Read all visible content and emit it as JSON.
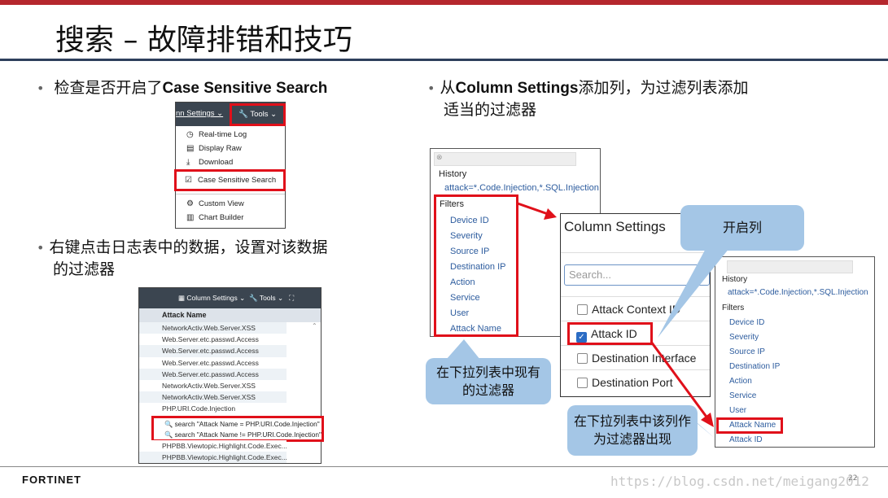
{
  "slide": {
    "title": "搜索 – 故障排错和技巧",
    "page_number": "22",
    "watermark": "https://blog.csdn.net/meigang2012",
    "logo_text": "FORTINET",
    "accent_color": "#b5272d",
    "rule_color": "#2e3f5c",
    "callout_color": "#a4c6e6"
  },
  "bullets": [
    {
      "pre": "检查是否开启了",
      "bold": "Case Sensitive Search",
      "post": ""
    },
    {
      "line1": "右键点击日志表中的数据，设置对该数据",
      "line2": "的过滤器"
    },
    {
      "pre": "从",
      "bold": "Column Settings",
      "post": "添加列，为过滤列表添加",
      "line2": "适当的过滤器"
    }
  ],
  "tools_menu": {
    "column_settings": "nn Settings ⌄",
    "tools": "Tools ⌄",
    "items": [
      {
        "icon": "clock-icon",
        "label": "Real-time Log"
      },
      {
        "icon": "document-icon",
        "label": "Display Raw"
      },
      {
        "icon": "download-icon",
        "label": "Download"
      },
      {
        "icon": "checkbox-icon",
        "label": "Case Sensitive Search"
      },
      {
        "icon": "user-settings-icon",
        "label": "Custom View"
      },
      {
        "icon": "bar-chart-icon",
        "label": "Chart Builder"
      }
    ]
  },
  "log_table": {
    "column_settings": "Column Settings ⌄",
    "tools": "Tools ⌄",
    "header": "Attack Name",
    "rows": [
      "NetworkActiv.Web.Server.XSS",
      "Web.Server.etc.passwd.Access",
      "Web.Server.etc.passwd.Access",
      "Web.Server.etc.passwd.Access",
      "Web.Server.etc.passwd.Access",
      "NetworkActiv.Web.Server.XSS",
      "NetworkActiv.Web.Server.XSS",
      "PHP.URI.Code.Injection"
    ],
    "context_menu": [
      "search \"Attack Name = PHP.URI.Code.Injection\"",
      "search \"Attack Name != PHP.URI.Code.Injection\""
    ],
    "rows_after": [
      "PHPBB.Viewtopic.Highlight.Code.Exec...",
      "PHPBB.Viewtopic.Highlight.Code.Exec..."
    ]
  },
  "filter_dropdown_1": {
    "history_label": "History",
    "history_item": "attack=*.Code.Injection,*.SQL.Injection",
    "filters_label": "Filters",
    "filters": [
      "Device ID",
      "Severity",
      "Source IP",
      "Destination IP",
      "Action",
      "Service",
      "User",
      "Attack Name"
    ]
  },
  "column_settings": {
    "title": "Column Settings",
    "search_placeholder": "Search...",
    "items": [
      {
        "label": "Attack Context ID",
        "checked": false
      },
      {
        "label": "Attack ID",
        "checked": true
      },
      {
        "label": "Destination Interface",
        "checked": false
      },
      {
        "label": "Destination Port",
        "checked": false
      }
    ]
  },
  "filter_dropdown_2": {
    "history_label": "History",
    "history_item": "attack=*.Code.Injection,*.SQL.Injection",
    "filters_label": "Filters",
    "filters": [
      "Device ID",
      "Severity",
      "Source IP",
      "Destination IP",
      "Action",
      "Service",
      "User",
      "Attack Name",
      "Attack ID"
    ]
  },
  "callouts": {
    "enable_column": "开启列",
    "existing_filters": "在下拉列表中现有的过滤器",
    "appears_as_filter": "在下拉列表中该列作为过滤器出现"
  }
}
